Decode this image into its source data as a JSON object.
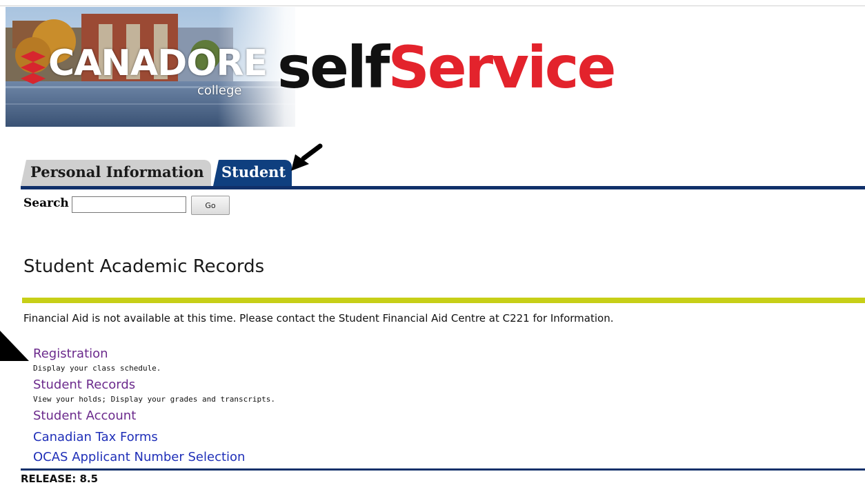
{
  "header": {
    "logo_name": "CANADORE",
    "logo_sub": "college",
    "brand_self": "self",
    "brand_service": "Service",
    "brand_colors": {
      "self": "#111111",
      "service": "#e3232c"
    }
  },
  "nav": {
    "tabs": [
      {
        "label": "Personal Information",
        "active": false
      },
      {
        "label": "Student",
        "active": true
      }
    ],
    "active_color": "#0f3f7f"
  },
  "search": {
    "label": "Search",
    "value": "",
    "button_label": "Go"
  },
  "main": {
    "title": "Student Academic Records",
    "message": "Financial Aid is not available at this time. Please contact the Student Financial Aid Centre at C221 for Information.",
    "menu": [
      {
        "label": "Registration",
        "description": "Display your class schedule.",
        "visited": true
      },
      {
        "label": "Student Records",
        "description": "View your holds; Display your grades and transcripts.",
        "visited": true
      },
      {
        "label": "Student Account",
        "description": "",
        "visited": true
      },
      {
        "label": "Canadian Tax Forms",
        "description": "",
        "visited": false
      },
      {
        "label": "OCAS Applicant Number Selection",
        "description": "",
        "visited": false
      }
    ]
  },
  "footer": {
    "release": "RELEASE: 8.5"
  }
}
